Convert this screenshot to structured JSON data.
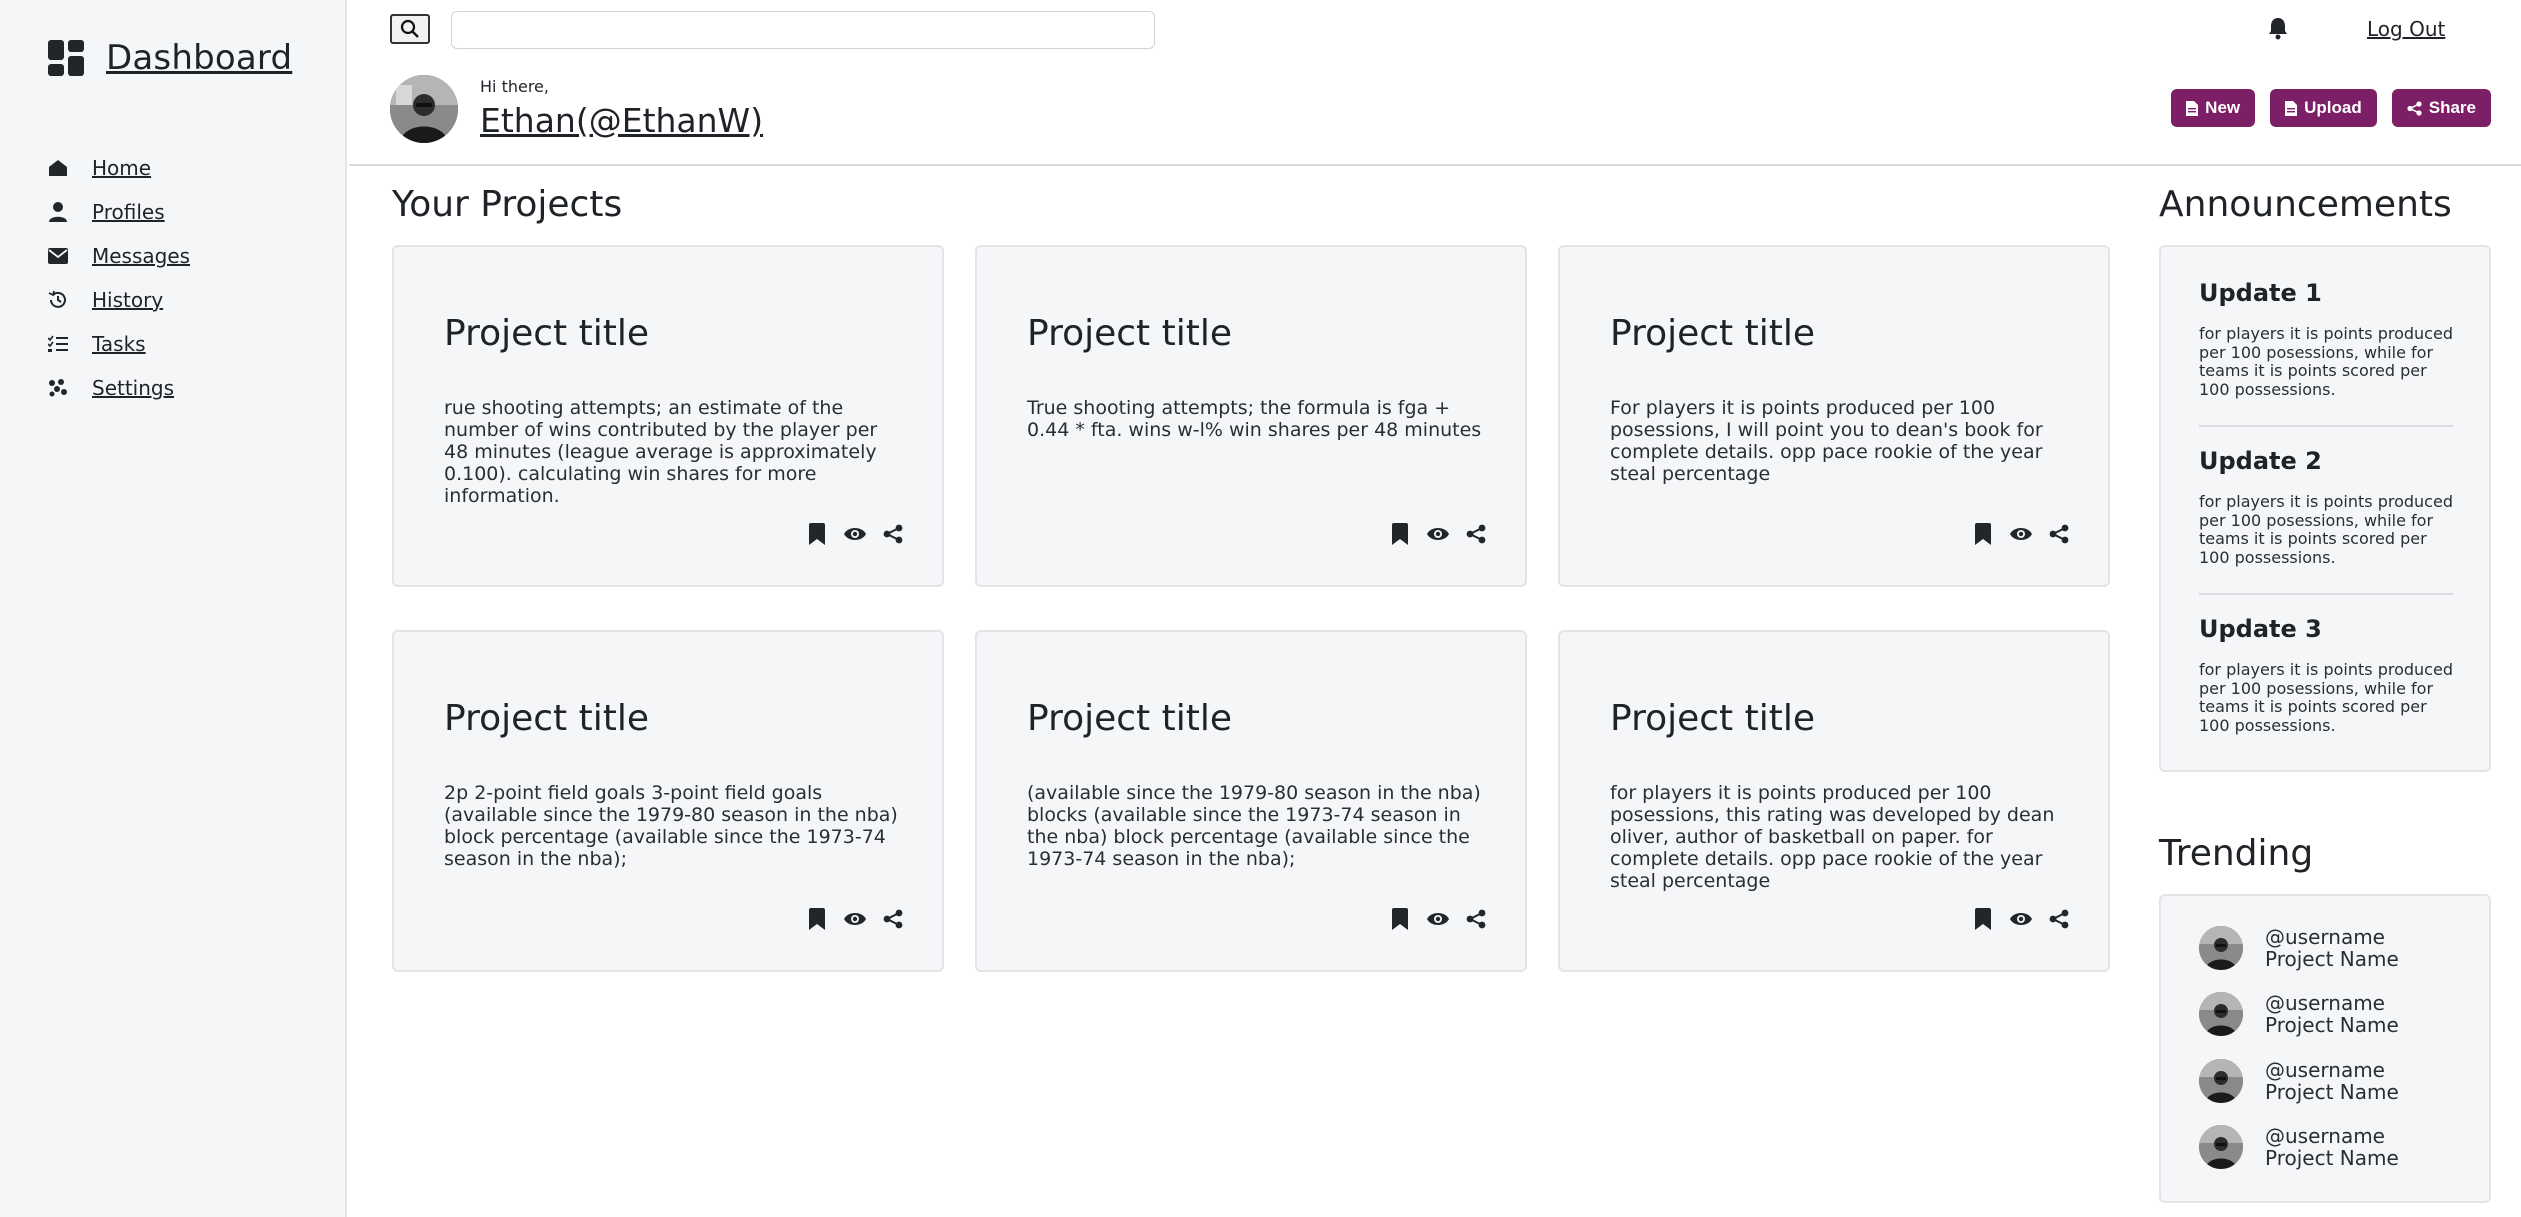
{
  "brand": {
    "title": "Dashboard"
  },
  "nav": [
    {
      "label": "Home",
      "icon": "home-icon"
    },
    {
      "label": "Profiles",
      "icon": "person-icon"
    },
    {
      "label": "Messages",
      "icon": "envelope-icon"
    },
    {
      "label": "History",
      "icon": "history-icon"
    },
    {
      "label": "Tasks",
      "icon": "tasks-icon"
    },
    {
      "label": "Settings",
      "icon": "settings-icon"
    }
  ],
  "header": {
    "search_value": "",
    "search_placeholder": "",
    "logout": "Log Out",
    "greeting": "Hi there,",
    "user": "Ethan(@EthanW)",
    "actions": {
      "new": "New",
      "upload": "Upload",
      "share": "Share"
    }
  },
  "projects": {
    "title": "Your Projects",
    "items": [
      {
        "title": "Project title",
        "body": "rue shooting attempts; an estimate of the number of wins contributed by the player per 48 minutes (league average is approximately 0.100). calculating win shares for more information."
      },
      {
        "title": "Project title",
        "body": "True shooting attempts; the formula is fga + 0.44 * fta. wins w-l% win shares per 48 minutes"
      },
      {
        "title": "Project title",
        "body": "For players it is points produced per 100 posessions, I will point you to dean's book for complete details. opp pace rookie of the year steal percentage"
      },
      {
        "title": "Project title",
        "body": "2p 2-point field goals 3-point field goals (available since the 1979-80 season in the nba) block percentage (available since the 1973-74 season in the nba);"
      },
      {
        "title": "Project title",
        "body": "(available since the 1979-80 season in the nba) blocks (available since the 1973-74 season in the nba) block percentage (available since the 1973-74 season in the nba);"
      },
      {
        "title": "Project title",
        "body": "for players it is points produced per 100 posessions, this rating was developed by dean oliver, author of basketball on paper. for complete details. opp pace rookie of the year steal percentage"
      }
    ]
  },
  "announcements": {
    "title": "Announcements",
    "items": [
      {
        "title": "Update 1",
        "text": "for players it is points produced per 100 posessions, while for teams it is points scored per 100 possessions."
      },
      {
        "title": "Update 2",
        "text": "for players it is points produced per 100 posessions, while for teams it is points scored per 100 possessions."
      },
      {
        "title": "Update 3",
        "text": "for players it is points produced per 100 posessions, while for teams it is points scored per 100 possessions."
      }
    ]
  },
  "trending": {
    "title": "Trending",
    "items": [
      {
        "user": "@username",
        "project": "Project Name"
      },
      {
        "user": "@username",
        "project": "Project Name"
      },
      {
        "user": "@username",
        "project": "Project Name"
      },
      {
        "user": "@username",
        "project": "Project Name"
      }
    ]
  },
  "colors": {
    "accent": "#7c1f66",
    "panel_bg": "#f5f6f8",
    "text": "#1f2328"
  }
}
